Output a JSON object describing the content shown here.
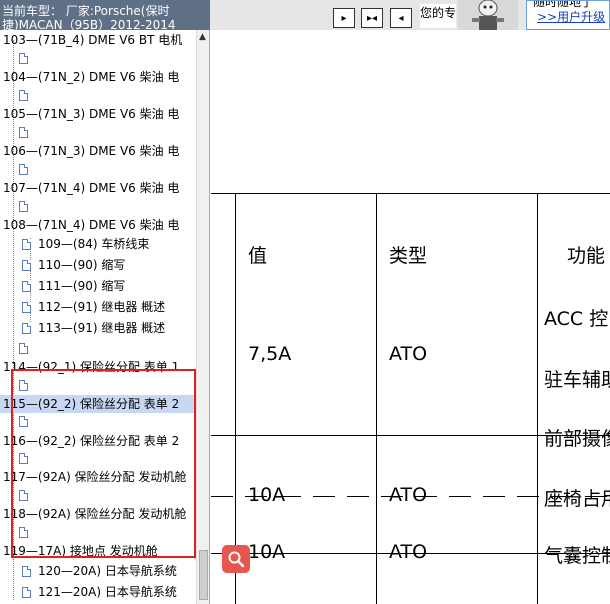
{
  "header": {
    "car_line1": "当前车型： 厂家:Porsche(保时",
    "car_line2": "捷)MACAN（95B）2012-2014",
    "nav_buttons": [
      "▸",
      "▸◂",
      "◂"
    ],
    "greeting": "您的专",
    "upgrade_tip": "随时随地了",
    "upgrade_link": ">>用户升级"
  },
  "tree": {
    "items": [
      {
        "label": "103—(71B_4) DME V6 BT 电机"
      },
      {
        "label": "104—(71N_2) DME V6 柴油 电"
      },
      {
        "label": "105—(71N_3) DME V6 柴油 电"
      },
      {
        "label": "106—(71N_3) DME V6 柴油 电"
      },
      {
        "label": "107—(71N_4) DME V6 柴油 电"
      },
      {
        "label": "108—(71N_4) DME V6 柴油 电"
      },
      {
        "label": "109—(84) 车桥线束"
      },
      {
        "label": "110—(90) 缩写"
      },
      {
        "label": "111—(90) 缩写"
      },
      {
        "label": "112—(91) 继电器 概述"
      },
      {
        "label": "113—(91) 继电器 概述"
      },
      {
        "label": "114—(92_1) 保险丝分配 表单 1"
      },
      {
        "label": "115—(92_2) 保险丝分配 表单 2"
      },
      {
        "label": "116—(92_2) 保险丝分配 表单 2"
      },
      {
        "label": "117—(92A) 保险丝分配 发动机舱"
      },
      {
        "label": "118—(92A) 保险丝分配 发动机舱"
      },
      {
        "label": "119—17A) 接地点 发动机舱"
      },
      {
        "label": "120—20A) 日本导航系统"
      },
      {
        "label": "121—20A) 日本导航系统"
      }
    ]
  },
  "table": {
    "headers": [
      "值",
      "类型",
      "功能"
    ],
    "rows": [
      {
        "value": "7,5A",
        "type": "ATO",
        "functions": [
          "ACC 控",
          "驻车辅助",
          "前部摄像"
        ]
      },
      {
        "value": "10A",
        "type": "ATO",
        "functions": [
          "座椅占用"
        ]
      },
      {
        "value": "10A",
        "type": "ATO",
        "functions": [
          "气囊控制"
        ]
      }
    ]
  },
  "colors": {
    "header_bg": "#5f6f86",
    "selection": "#c8d8f2",
    "highlight_border": "#e02020",
    "search_button": "#e8554e"
  }
}
